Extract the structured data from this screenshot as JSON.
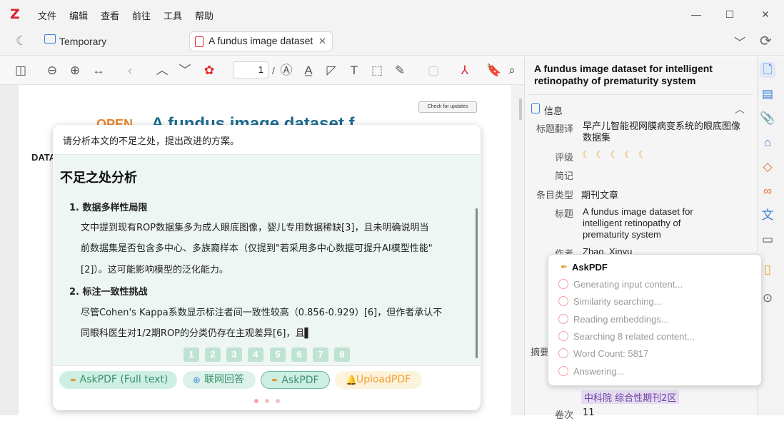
{
  "menubar": {
    "logo": "Z",
    "items": [
      "文件",
      "编辑",
      "查看",
      "前往",
      "工具",
      "帮助"
    ]
  },
  "tabs": {
    "library": "Temporary",
    "active": "A fundus image dataset"
  },
  "toolbar": {
    "page_value": "1",
    "page_sep": "/"
  },
  "pane": {
    "title": "A fundus image dataset for intelligent retinopathy of prematurity system",
    "section": "信息",
    "rows": [
      {
        "label": "标题翻译",
        "value": "早产儿智能视网膜病变系统的眼底图像数据集"
      },
      {
        "label": "评级",
        "value": ""
      },
      {
        "label": "简记",
        "value": ""
      },
      {
        "label": "条目类型",
        "value": "期刊文章"
      },
      {
        "label": "标题",
        "value": "A fundus image dataset for intelligent retinopathy of prematurity system"
      },
      {
        "label": "作者",
        "value": "Zhao, Xinyu"
      }
    ],
    "partial_label": "摘要",
    "badge": "中科院 综合性期刊2区",
    "partial_bottom": "卷次",
    "partial_bottom_val": "11"
  },
  "doc": {
    "open_text": "OPEN",
    "heading_fragment": "A fundus image dataset f",
    "data_label": "DATA",
    "check_updates": "Check for updates"
  },
  "chat": {
    "question": "请分析本文的不足之处，提出改进的方案。",
    "heading": "不足之处分析",
    "items": [
      {
        "title": "1. 数据多样性局限",
        "lines": [
          "文中提到现有ROP数据集多为成人眼底图像，婴儿专用数据稀缺[3]，且未明确说明当",
          "前数据集是否包含多中心、多族裔样本（仅提到\"若采用多中心数据可提升AI模型性能\"",
          "[2]）。这可能影响模型的泛化能力。"
        ]
      },
      {
        "title": "2. 标注一致性挑战",
        "lines": [
          "尽管Cohen's Kappa系数显示标注者间一致性较高（0.856-0.929）[6]，但作者承认不",
          "同眼科医生对1/2期ROP的分类仍存在主观差异[6]，且▌"
        ]
      }
    ],
    "pages": [
      "1",
      "2",
      "3",
      "4",
      "5",
      "6",
      "7",
      "8"
    ],
    "buttons": {
      "askpdf_full": "AskPDF (Full text)",
      "web": "联网回答",
      "askpdf": "AskPDF",
      "upload": "UploadPDF"
    }
  },
  "popup": {
    "title": "AskPDF",
    "steps": [
      "Generating input content...",
      "Similarity searching...",
      "Reading embeddings...",
      "Searching 8 related content...",
      "Word Count: 5817",
      "Answering..."
    ]
  },
  "colors": {
    "accent_green": "#bfe3d3",
    "logo_red": "#d9232d",
    "pdf_red": "#e02a2a"
  }
}
